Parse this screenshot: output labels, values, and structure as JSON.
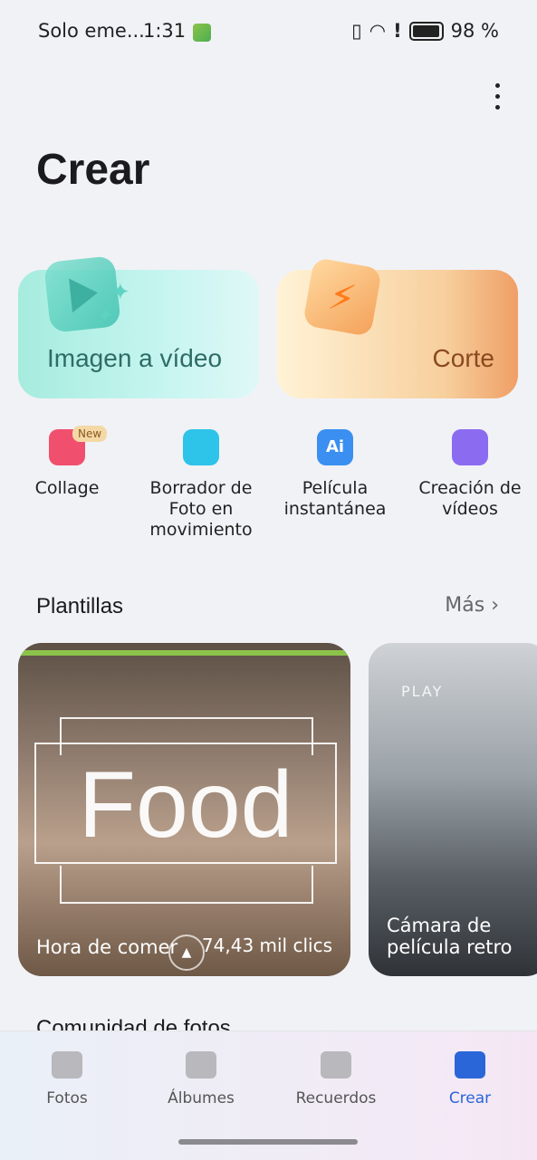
{
  "status_bar": {
    "carrier": "Solo eme...",
    "time": "1:31",
    "battery": "98 %"
  },
  "header": {
    "title": "Crear"
  },
  "feature_cards": [
    {
      "label": "Imagen a vídeo",
      "icon": "play-sparkle-icon",
      "color": "#a6ecde"
    },
    {
      "label": "Corte",
      "icon": "lightning-icon",
      "color": "#f7cf9c"
    }
  ],
  "tools": [
    {
      "label": "Collage",
      "icon": "collage-icon",
      "badge": "New",
      "color": "#f0506e"
    },
    {
      "label": "Borrador de Foto en movimiento",
      "icon": "motion-eraser-icon",
      "color": "#2ec3e8"
    },
    {
      "label": "Película instantánea",
      "icon": "ai-film-icon",
      "color": "#3a8ff0"
    },
    {
      "label": "Creación de vídeos",
      "icon": "video-camera-icon",
      "color": "#8b6cf0"
    }
  ],
  "templates_section": {
    "title": "Plantillas",
    "more": "Más",
    "items": [
      {
        "overlay_text": "Food",
        "caption": "Hora de comer",
        "clicks": "74,43 mil clics"
      },
      {
        "overlay_text": "PLAY",
        "caption": "Cámara de película retro",
        "clicks": ""
      }
    ]
  },
  "community_section": {
    "title": "Comunidad de fotos"
  },
  "bottom_nav": [
    {
      "label": "Fotos",
      "icon": "photos-icon",
      "active": false
    },
    {
      "label": "Álbumes",
      "icon": "albums-icon",
      "active": false
    },
    {
      "label": "Recuerdos",
      "icon": "memories-icon",
      "active": false
    },
    {
      "label": "Crear",
      "icon": "create-icon",
      "active": true
    }
  ],
  "colors": {
    "accent": "#2a66d8",
    "new_badge": "#f4d9a6"
  }
}
